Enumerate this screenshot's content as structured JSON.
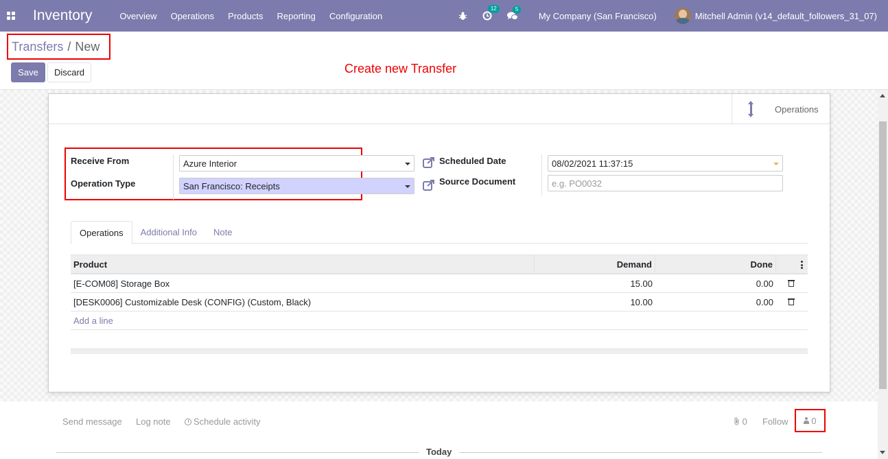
{
  "navbar": {
    "app_title": "Inventory",
    "menu": [
      "Overview",
      "Operations",
      "Products",
      "Reporting",
      "Configuration"
    ],
    "activity_count": "12",
    "message_count": "5",
    "company": "My Company (San Francisco)",
    "user": "Mitchell Admin (v14_default_followers_31_07)",
    "bg_color": "#7c7bad"
  },
  "breadcrumb": {
    "parent": "Transfers",
    "separator": "/",
    "current": "New"
  },
  "buttons": {
    "save": "Save",
    "discard": "Discard"
  },
  "annotation": "Create new Transfer",
  "smart_button": {
    "label": "Operations",
    "icon": "arrows-v-icon"
  },
  "fields": {
    "receive_from": {
      "label": "Receive From",
      "value": "Azure Interior"
    },
    "operation_type": {
      "label": "Operation Type",
      "value": "San Francisco: Receipts"
    },
    "scheduled_date": {
      "label": "Scheduled Date",
      "value": "08/02/2021 11:37:15"
    },
    "source_document": {
      "label": "Source Document",
      "placeholder": "e.g. PO0032"
    }
  },
  "tabs": [
    "Operations",
    "Additional Info",
    "Note"
  ],
  "table": {
    "headers": {
      "product": "Product",
      "demand": "Demand",
      "done": "Done"
    },
    "rows": [
      {
        "product": "[E-COM08] Storage Box",
        "demand": "15.00",
        "done": "0.00"
      },
      {
        "product": "[DESK0006] Customizable Desk (CONFIG) (Custom, Black)",
        "demand": "10.00",
        "done": "0.00"
      }
    ],
    "add_line": "Add a line"
  },
  "chatter": {
    "send_message": "Send message",
    "log_note": "Log note",
    "schedule_activity": "Schedule activity",
    "attachments": "0",
    "follow": "Follow",
    "followers": "0",
    "today": "Today"
  }
}
